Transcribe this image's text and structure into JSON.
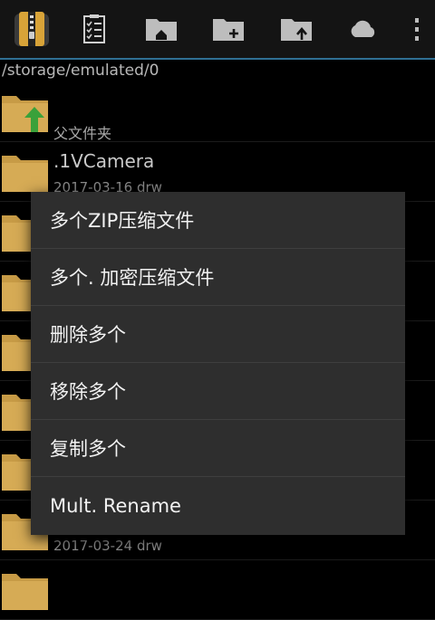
{
  "toolbar": {
    "icons": [
      "app-logo-icon",
      "checklist-icon",
      "home-folder-icon",
      "new-folder-icon",
      "upload-folder-icon",
      "cloud-icon",
      "more-vert-icon"
    ],
    "accent": "#2f6f93"
  },
  "path": "/storage/emulated/0",
  "parent": {
    "label": "父文件夹"
  },
  "files": [
    {
      "name": ".1VCamera",
      "meta": "2017-03-16 drw"
    },
    {
      "name": "",
      "meta": ""
    },
    {
      "name": "",
      "meta": ""
    },
    {
      "name": "",
      "meta": ""
    },
    {
      "name": "",
      "meta": ""
    },
    {
      "name": "",
      "meta": ""
    },
    {
      "name": "",
      "meta": "2017-03-24 drw"
    }
  ],
  "menu": {
    "items": [
      {
        "label": "多个ZIP压缩文件"
      },
      {
        "label": "多个. 加密压缩文件"
      },
      {
        "label": "删除多个"
      },
      {
        "label": "移除多个"
      },
      {
        "label": "复制多个"
      },
      {
        "label": "Mult. Rename"
      }
    ]
  },
  "colors": {
    "folder": "#c79b46",
    "arrow": "#3aa13a",
    "menu_bg": "#2e2e2e"
  }
}
